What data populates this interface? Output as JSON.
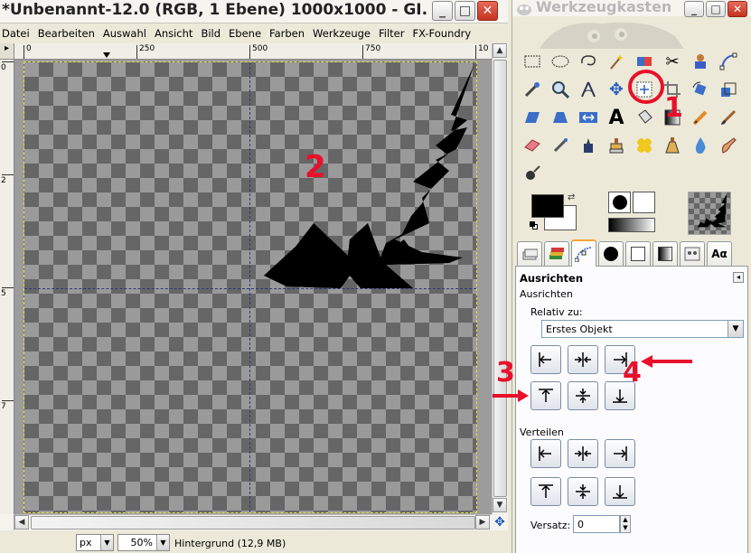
{
  "image_window": {
    "title": "*Unbenannt-12.0 (RGB, 1 Ebene) 1000x1000 - GI...",
    "window_buttons": {
      "minimize": "_",
      "maximize": "□",
      "close": "✕"
    },
    "menu": [
      "Datei",
      "Bearbeiten",
      "Auswahl",
      "Ansicht",
      "Bild",
      "Ebene",
      "Farben",
      "Werkzeuge",
      "Filter",
      "FX-Foundry"
    ],
    "ruler_h_labels": [
      "0",
      "250",
      "500",
      "750",
      "10"
    ],
    "ruler_v_labels": [
      "0",
      "2",
      "5",
      "7"
    ],
    "status": {
      "unit": "px",
      "zoom": "50%",
      "layer_info": "Hintergrund (12,9 MB)"
    }
  },
  "toolbox": {
    "title": "Werkzeugkasten",
    "window_buttons": {
      "minimize": "_",
      "maximize": "□",
      "close": "✕"
    },
    "tabs": [
      "tool-options",
      "layers",
      "paths",
      "brushes",
      "patterns",
      "gradients",
      "images",
      "fonts"
    ],
    "tab_font_label": "Aα",
    "options": {
      "header": "Ausrichten",
      "subheader": "Ausrichten",
      "relative_label": "Relativ zu:",
      "relative_value": "Erstes Objekt",
      "distribute_label": "Verteilen",
      "offset_label": "Versatz:",
      "offset_value": "0"
    }
  },
  "annotations": {
    "n1": "1",
    "n2": "2",
    "n3": "3",
    "n4": "4",
    "color": "#e8102a"
  },
  "colors": {
    "foreground": "#000000",
    "background": "#ffffff",
    "accent_tab": "#f1a838"
  }
}
